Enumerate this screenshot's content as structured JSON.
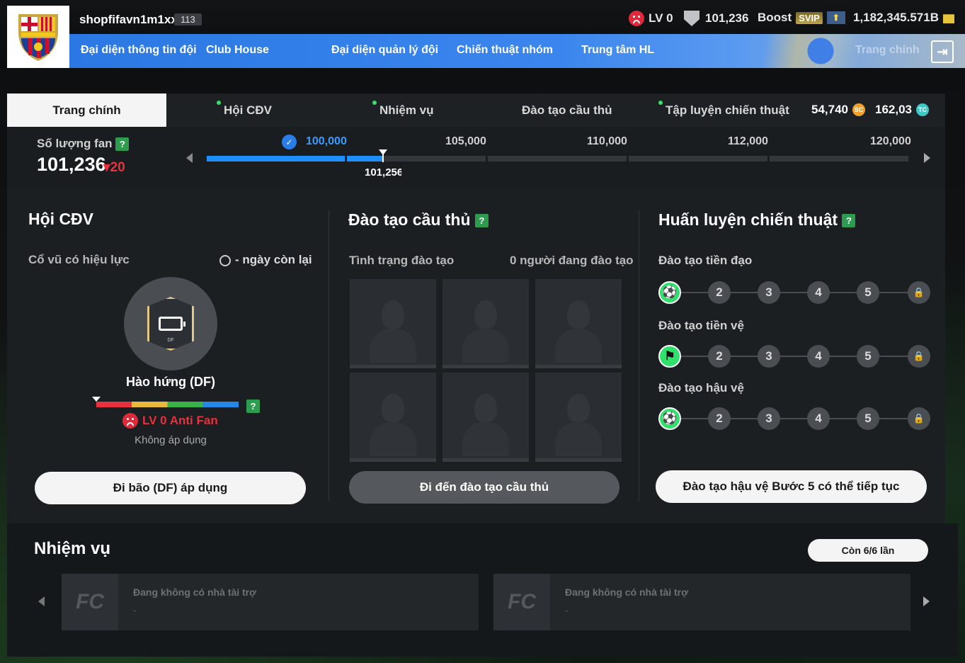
{
  "header": {
    "username": "shopfifavn1m1xx",
    "user_level": "113",
    "lv": "LV 0",
    "fans": "101,236",
    "boost_label": "Boost",
    "svip": "SVIP",
    "bp": "1,182,345.571B"
  },
  "nav": {
    "items": [
      "Đại diện thông tin đội",
      "Club House",
      "Đại diện quản lý đội",
      "Chiến thuật nhóm",
      "Trung tâm HL",
      "Trang chính"
    ]
  },
  "subtabs": {
    "active": "Trang chính",
    "items": [
      "Hội CĐV",
      "Nhiệm vụ",
      "Đào tạo cầu thủ",
      "Tập luyện chiến thuật"
    ],
    "sc": "54,740",
    "tc": "162,03"
  },
  "fanbar": {
    "label": "Số lượng fan",
    "count": "101,236",
    "delta": "20",
    "milestones": [
      "100,000",
      "105,000",
      "110,000",
      "112,000",
      "120,000"
    ],
    "progress": 0.03,
    "current": "101,256"
  },
  "cdv": {
    "title": "Hội CĐV",
    "effect_label": "Cổ vũ có hiệu lực",
    "days_left": "- ngày còn lại",
    "badge_text": "DF",
    "hype_name": "Hào hứng (DF)",
    "level": "LV 0 Anti Fan",
    "status": "Không áp dụng",
    "button": "Đi bão (DF) áp dụng"
  },
  "training": {
    "title": "Đào tạo cầu thủ",
    "status_label": "Tình trạng đào tạo",
    "count_label": "0 người đang đào tạo",
    "button": "Đi đến đào tạo cầu thủ"
  },
  "tactics": {
    "title": "Huấn luyện chiến thuật",
    "rows": [
      {
        "label": "Đào tạo tiền đạo",
        "steps": [
          "2",
          "3",
          "4",
          "5"
        ]
      },
      {
        "label": "Đào tạo tiền vệ",
        "steps": [
          "2",
          "3",
          "4",
          "5"
        ]
      },
      {
        "label": "Đào tạo hậu vệ",
        "steps": [
          "2",
          "3",
          "4",
          "5"
        ]
      }
    ],
    "button": "Đào tạo hậu vệ Bước 5 có thể tiếp tục"
  },
  "missions": {
    "title": "Nhiệm vụ",
    "count": "Còn 6/6 lần",
    "cards": [
      {
        "text": "Đang không có nhà tài trợ",
        "sub": "-"
      },
      {
        "text": "Đang không có nhà tài trợ",
        "sub": "-"
      }
    ]
  },
  "colors": {
    "accent_blue": "#2b78e4",
    "active_green": "#2fe06a",
    "negative_red": "#e8303e"
  }
}
